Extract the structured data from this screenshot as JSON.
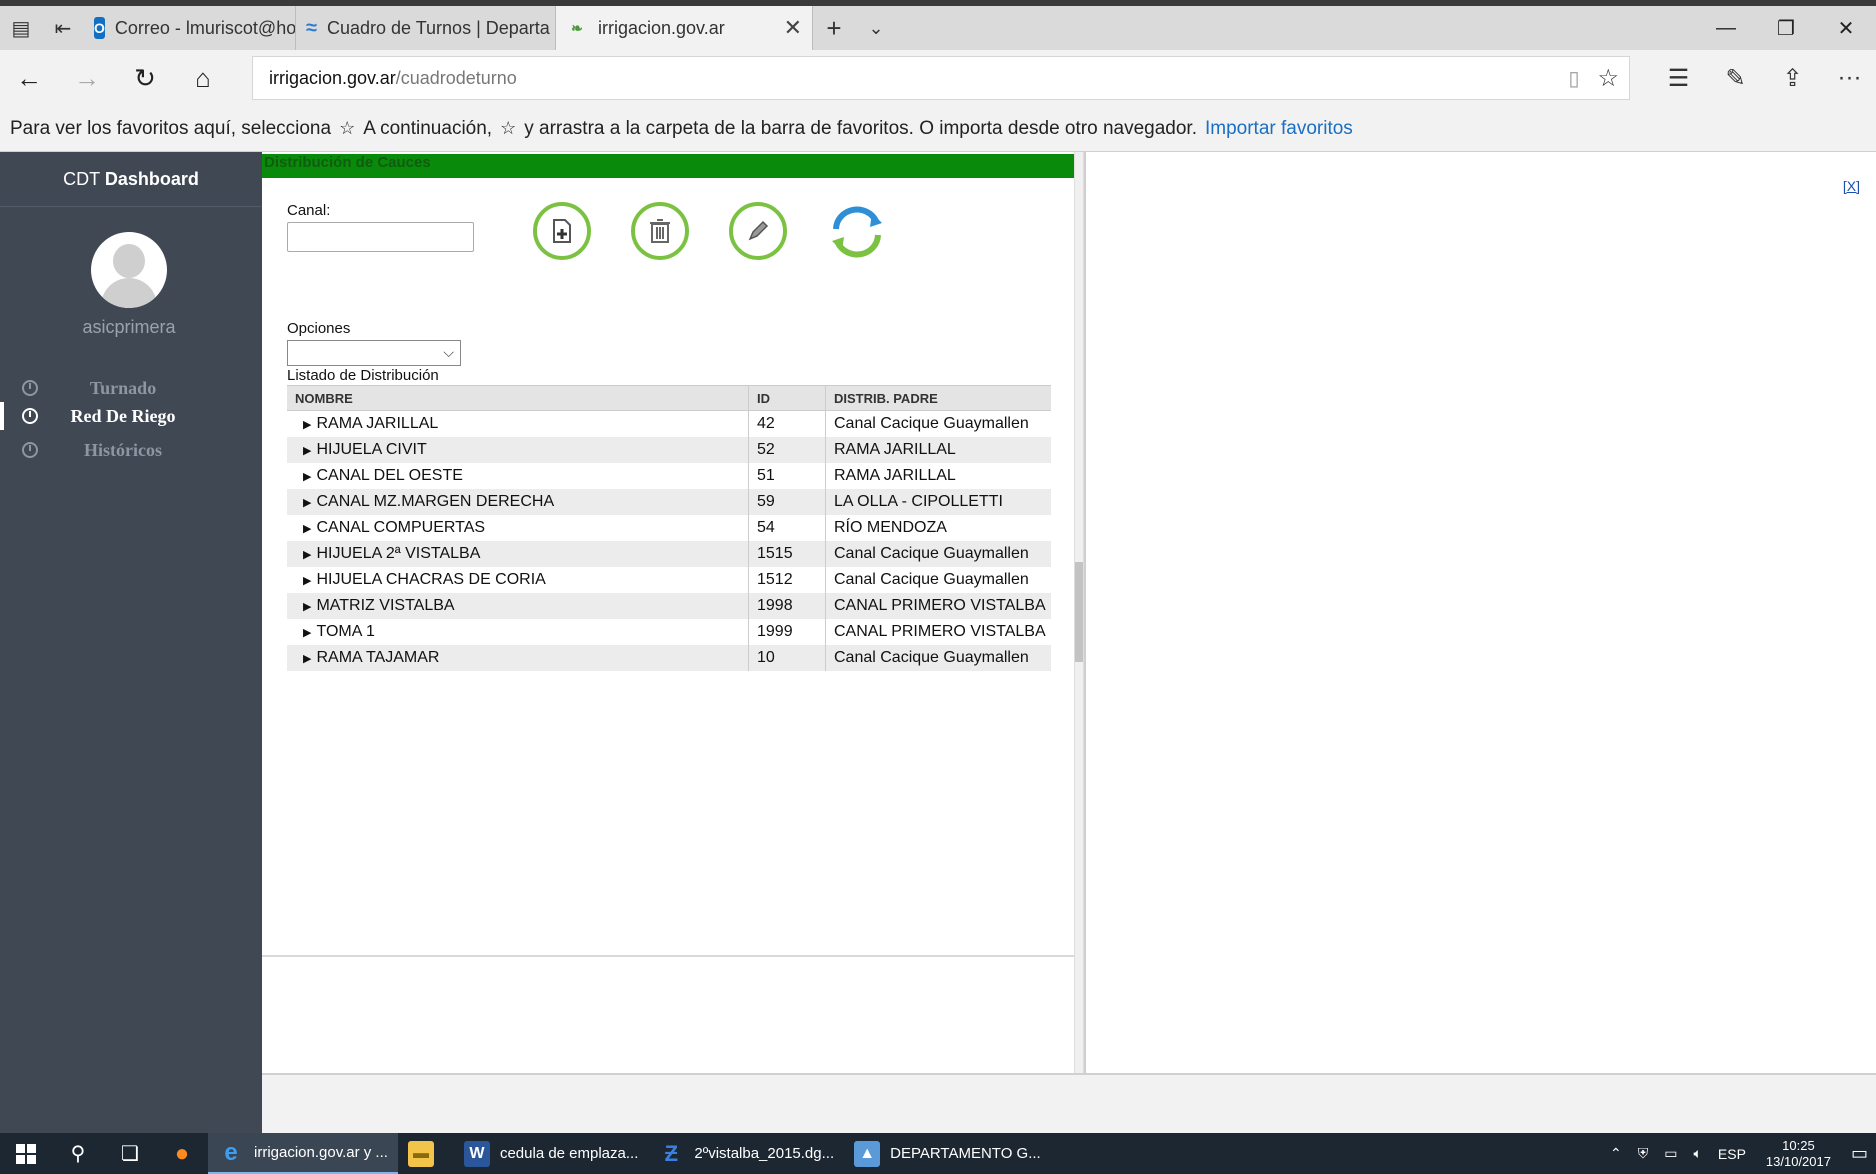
{
  "browser": {
    "tabs": [
      {
        "title": "Correo - lmuriscot@hotmai",
        "icon": "outlook-icon"
      },
      {
        "title": "Cuadro de Turnos | Departa",
        "icon": "waves-icon"
      },
      {
        "title": "irrigacion.gov.ar",
        "icon": "leaf-icon",
        "active": true
      }
    ],
    "url_host": "irrigacion.gov.ar",
    "url_path": "/cuadrodeturno",
    "favbar_text_1": "Para ver los favoritos aquí, selecciona",
    "favbar_text_2": "A continuación,",
    "favbar_text_3": "y arrastra a la carpeta de la barra de favoritos. O importa desde otro navegador.",
    "favbar_link": "Importar favoritos"
  },
  "sidebar": {
    "brand_prefix": "CDT",
    "brand_bold": "Dashboard",
    "username": "asicprimera",
    "menu": [
      {
        "label": "Turnado"
      },
      {
        "label": "Red De Riego",
        "active": true
      },
      {
        "label": "Históricos"
      }
    ]
  },
  "panel": {
    "title": "Distribución de Cauces",
    "canal_label": "Canal:",
    "canal_value": "",
    "opciones_label": "Opciones",
    "opciones_value": "",
    "listado_label": "Listado de Distribución",
    "close_link": "[X]"
  },
  "table": {
    "columns": [
      "NOMBRE",
      "ID",
      "DISTRIB. PADRE"
    ],
    "rows": [
      {
        "nombre": "RAMA JARILLAL",
        "id": "42",
        "padre": "Canal Cacique Guaymallen"
      },
      {
        "nombre": "HIJUELA CIVIT",
        "id": "52",
        "padre": "RAMA JARILLAL"
      },
      {
        "nombre": "CANAL DEL OESTE",
        "id": "51",
        "padre": "RAMA JARILLAL"
      },
      {
        "nombre": "CANAL MZ.MARGEN DERECHA",
        "id": "59",
        "padre": "LA OLLA - CIPOLLETTI"
      },
      {
        "nombre": "CANAL COMPUERTAS",
        "id": "54",
        "padre": "RÍO MENDOZA"
      },
      {
        "nombre": "HIJUELA 2ª VISTALBA",
        "id": "1515",
        "padre": "Canal Cacique Guaymallen"
      },
      {
        "nombre": "HIJUELA CHACRAS DE CORIA",
        "id": "1512",
        "padre": "Canal Cacique Guaymallen"
      },
      {
        "nombre": "MATRIZ VISTALBA",
        "id": "1998",
        "padre": "CANAL PRIMERO VISTALBA"
      },
      {
        "nombre": "TOMA 1",
        "id": "1999",
        "padre": "CANAL PRIMERO VISTALBA"
      },
      {
        "nombre": "RAMA TAJAMAR",
        "id": "10",
        "padre": "Canal Cacique Guaymallen"
      }
    ]
  },
  "taskbar": {
    "apps": [
      {
        "label": "irrigacion.gov.ar y ...",
        "icon": "edge-icon",
        "active": true
      },
      {
        "label": "",
        "icon": "folder-icon"
      },
      {
        "label": "cedula de emplaza...",
        "icon": "word-icon"
      },
      {
        "label": "2ºvistalba_2015.dg...",
        "icon": "cad-icon"
      },
      {
        "label": "DEPARTAMENTO G...",
        "icon": "image-icon"
      }
    ],
    "lang": "ESP",
    "time": "10:25",
    "date": "13/10/2017"
  },
  "colors": {
    "sidebar": "#3f4853",
    "panel_title": "#0a8a0a",
    "button_ring": "#7cc242",
    "link": "#1a6fc2"
  }
}
